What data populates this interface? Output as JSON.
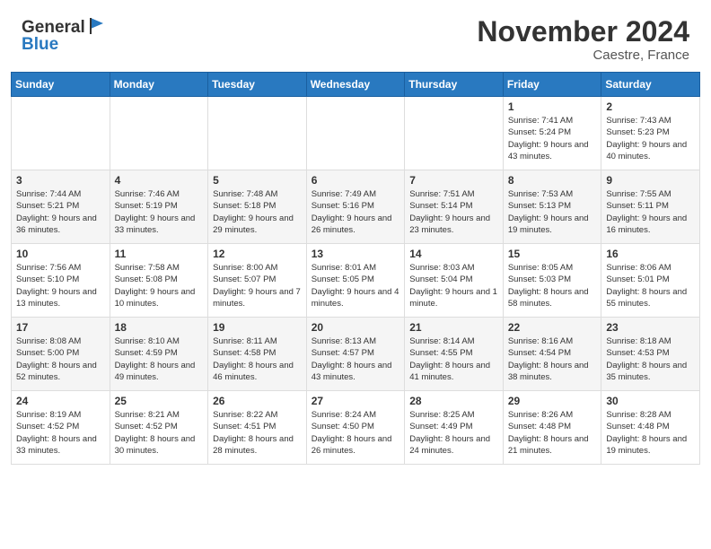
{
  "header": {
    "logo_general": "General",
    "logo_blue": "Blue",
    "month_title": "November 2024",
    "location": "Caestre, France"
  },
  "calendar": {
    "columns": [
      "Sunday",
      "Monday",
      "Tuesday",
      "Wednesday",
      "Thursday",
      "Friday",
      "Saturday"
    ],
    "weeks": [
      [
        {
          "day": "",
          "info": ""
        },
        {
          "day": "",
          "info": ""
        },
        {
          "day": "",
          "info": ""
        },
        {
          "day": "",
          "info": ""
        },
        {
          "day": "",
          "info": ""
        },
        {
          "day": "1",
          "info": "Sunrise: 7:41 AM\nSunset: 5:24 PM\nDaylight: 9 hours\nand 43 minutes."
        },
        {
          "day": "2",
          "info": "Sunrise: 7:43 AM\nSunset: 5:23 PM\nDaylight: 9 hours\nand 40 minutes."
        }
      ],
      [
        {
          "day": "3",
          "info": "Sunrise: 7:44 AM\nSunset: 5:21 PM\nDaylight: 9 hours\nand 36 minutes."
        },
        {
          "day": "4",
          "info": "Sunrise: 7:46 AM\nSunset: 5:19 PM\nDaylight: 9 hours\nand 33 minutes."
        },
        {
          "day": "5",
          "info": "Sunrise: 7:48 AM\nSunset: 5:18 PM\nDaylight: 9 hours\nand 29 minutes."
        },
        {
          "day": "6",
          "info": "Sunrise: 7:49 AM\nSunset: 5:16 PM\nDaylight: 9 hours\nand 26 minutes."
        },
        {
          "day": "7",
          "info": "Sunrise: 7:51 AM\nSunset: 5:14 PM\nDaylight: 9 hours\nand 23 minutes."
        },
        {
          "day": "8",
          "info": "Sunrise: 7:53 AM\nSunset: 5:13 PM\nDaylight: 9 hours\nand 19 minutes."
        },
        {
          "day": "9",
          "info": "Sunrise: 7:55 AM\nSunset: 5:11 PM\nDaylight: 9 hours\nand 16 minutes."
        }
      ],
      [
        {
          "day": "10",
          "info": "Sunrise: 7:56 AM\nSunset: 5:10 PM\nDaylight: 9 hours\nand 13 minutes."
        },
        {
          "day": "11",
          "info": "Sunrise: 7:58 AM\nSunset: 5:08 PM\nDaylight: 9 hours\nand 10 minutes."
        },
        {
          "day": "12",
          "info": "Sunrise: 8:00 AM\nSunset: 5:07 PM\nDaylight: 9 hours\nand 7 minutes."
        },
        {
          "day": "13",
          "info": "Sunrise: 8:01 AM\nSunset: 5:05 PM\nDaylight: 9 hours\nand 4 minutes."
        },
        {
          "day": "14",
          "info": "Sunrise: 8:03 AM\nSunset: 5:04 PM\nDaylight: 9 hours\nand 1 minute."
        },
        {
          "day": "15",
          "info": "Sunrise: 8:05 AM\nSunset: 5:03 PM\nDaylight: 8 hours\nand 58 minutes."
        },
        {
          "day": "16",
          "info": "Sunrise: 8:06 AM\nSunset: 5:01 PM\nDaylight: 8 hours\nand 55 minutes."
        }
      ],
      [
        {
          "day": "17",
          "info": "Sunrise: 8:08 AM\nSunset: 5:00 PM\nDaylight: 8 hours\nand 52 minutes."
        },
        {
          "day": "18",
          "info": "Sunrise: 8:10 AM\nSunset: 4:59 PM\nDaylight: 8 hours\nand 49 minutes."
        },
        {
          "day": "19",
          "info": "Sunrise: 8:11 AM\nSunset: 4:58 PM\nDaylight: 8 hours\nand 46 minutes."
        },
        {
          "day": "20",
          "info": "Sunrise: 8:13 AM\nSunset: 4:57 PM\nDaylight: 8 hours\nand 43 minutes."
        },
        {
          "day": "21",
          "info": "Sunrise: 8:14 AM\nSunset: 4:55 PM\nDaylight: 8 hours\nand 41 minutes."
        },
        {
          "day": "22",
          "info": "Sunrise: 8:16 AM\nSunset: 4:54 PM\nDaylight: 8 hours\nand 38 minutes."
        },
        {
          "day": "23",
          "info": "Sunrise: 8:18 AM\nSunset: 4:53 PM\nDaylight: 8 hours\nand 35 minutes."
        }
      ],
      [
        {
          "day": "24",
          "info": "Sunrise: 8:19 AM\nSunset: 4:52 PM\nDaylight: 8 hours\nand 33 minutes."
        },
        {
          "day": "25",
          "info": "Sunrise: 8:21 AM\nSunset: 4:52 PM\nDaylight: 8 hours\nand 30 minutes."
        },
        {
          "day": "26",
          "info": "Sunrise: 8:22 AM\nSunset: 4:51 PM\nDaylight: 8 hours\nand 28 minutes."
        },
        {
          "day": "27",
          "info": "Sunrise: 8:24 AM\nSunset: 4:50 PM\nDaylight: 8 hours\nand 26 minutes."
        },
        {
          "day": "28",
          "info": "Sunrise: 8:25 AM\nSunset: 4:49 PM\nDaylight: 8 hours\nand 24 minutes."
        },
        {
          "day": "29",
          "info": "Sunrise: 8:26 AM\nSunset: 4:48 PM\nDaylight: 8 hours\nand 21 minutes."
        },
        {
          "day": "30",
          "info": "Sunrise: 8:28 AM\nSunset: 4:48 PM\nDaylight: 8 hours\nand 19 minutes."
        }
      ]
    ]
  }
}
